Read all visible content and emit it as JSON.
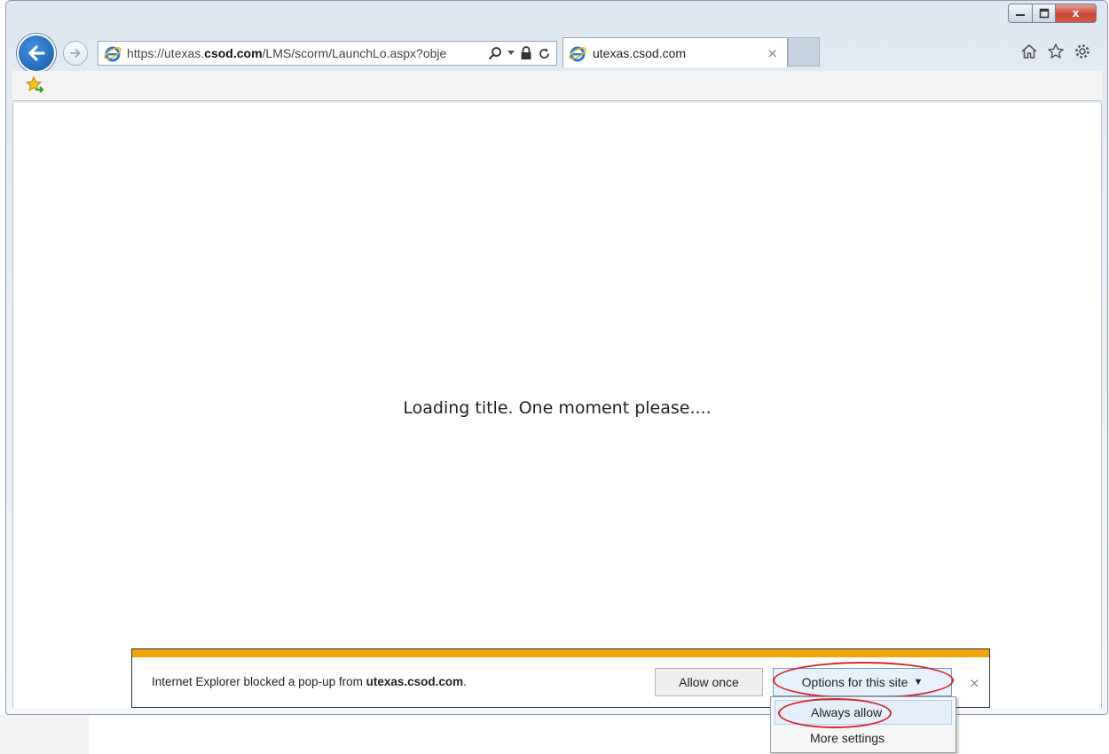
{
  "browser": {
    "address": {
      "url_prefix": "https://utexas.",
      "url_domain": "csod.com",
      "url_suffix": "/LMS/scorm/LaunchLo.aspx?obje"
    },
    "tab": {
      "title": "utexas.csod.com",
      "close": "×"
    },
    "caption": {
      "close": "x"
    }
  },
  "page": {
    "loading_text": "Loading title. One moment please...."
  },
  "notification": {
    "message_prefix": "Internet Explorer blocked a pop-up from ",
    "message_site": "utexas.csod.com",
    "message_suffix": ".",
    "allow_once": "Allow once",
    "options": "Options for this site",
    "close": "×"
  },
  "options_menu": {
    "items": [
      "Always allow",
      "More settings"
    ]
  },
  "colors": {
    "accent_bar": "#f0a30a",
    "highlight_ring": "#d7262b",
    "back_button": "#1a5ba8"
  },
  "icons": [
    "back-arrow-icon",
    "forward-arrow-icon",
    "ie-logo-icon",
    "search-icon",
    "dropdown-arrow-icon",
    "lock-icon",
    "refresh-icon",
    "home-icon",
    "favorites-star-icon",
    "gear-icon",
    "add-favorites-icon"
  ]
}
